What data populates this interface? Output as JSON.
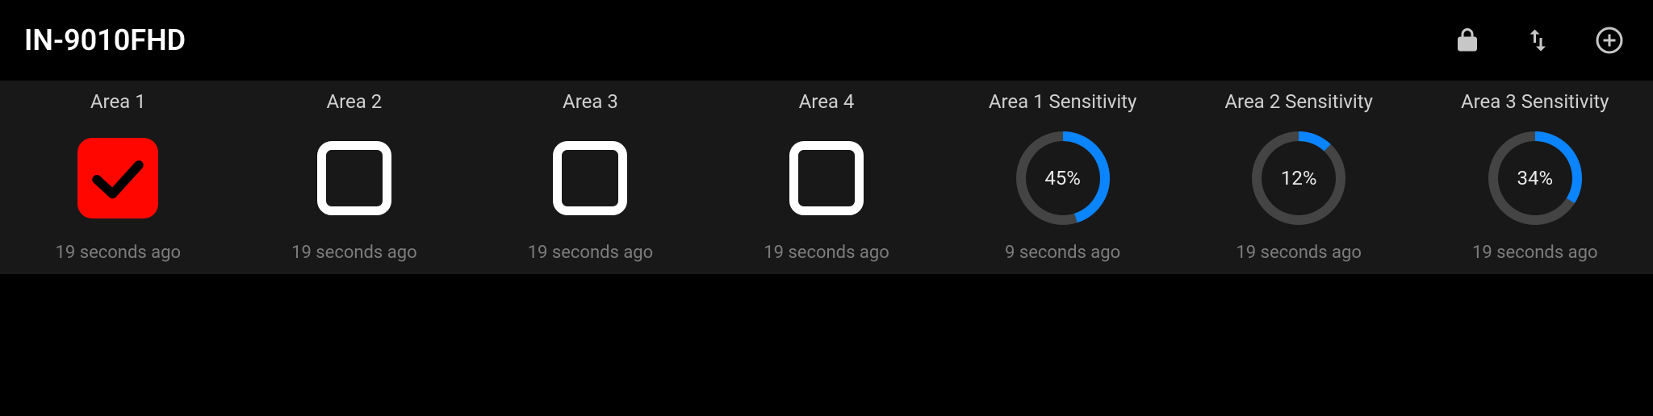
{
  "header": {
    "title": "IN-9010FHD"
  },
  "icons": {
    "lock": "lock-icon",
    "sort": "swap-vert-icon",
    "add": "plus-circle-icon"
  },
  "colors": {
    "accent": "#0a84ff",
    "alert": "#ff0600",
    "track": "#444444",
    "panel": "#181818"
  },
  "tiles": [
    {
      "kind": "checkbox",
      "title": "Area 1",
      "checked": true,
      "sub": "19 seconds ago"
    },
    {
      "kind": "checkbox",
      "title": "Area 2",
      "checked": false,
      "sub": "19 seconds ago"
    },
    {
      "kind": "checkbox",
      "title": "Area 3",
      "checked": false,
      "sub": "19 seconds ago"
    },
    {
      "kind": "checkbox",
      "title": "Area 4",
      "checked": false,
      "sub": "19 seconds ago"
    },
    {
      "kind": "gauge",
      "title": "Area 1 Sensitivity",
      "percent": 45,
      "display": "45%",
      "sub": "9 seconds ago"
    },
    {
      "kind": "gauge",
      "title": "Area 2 Sensitivity",
      "percent": 12,
      "display": "12%",
      "sub": "19 seconds ago"
    },
    {
      "kind": "gauge",
      "title": "Area 3 Sensitivity",
      "percent": 34,
      "display": "34%",
      "sub": "19 seconds ago"
    }
  ]
}
